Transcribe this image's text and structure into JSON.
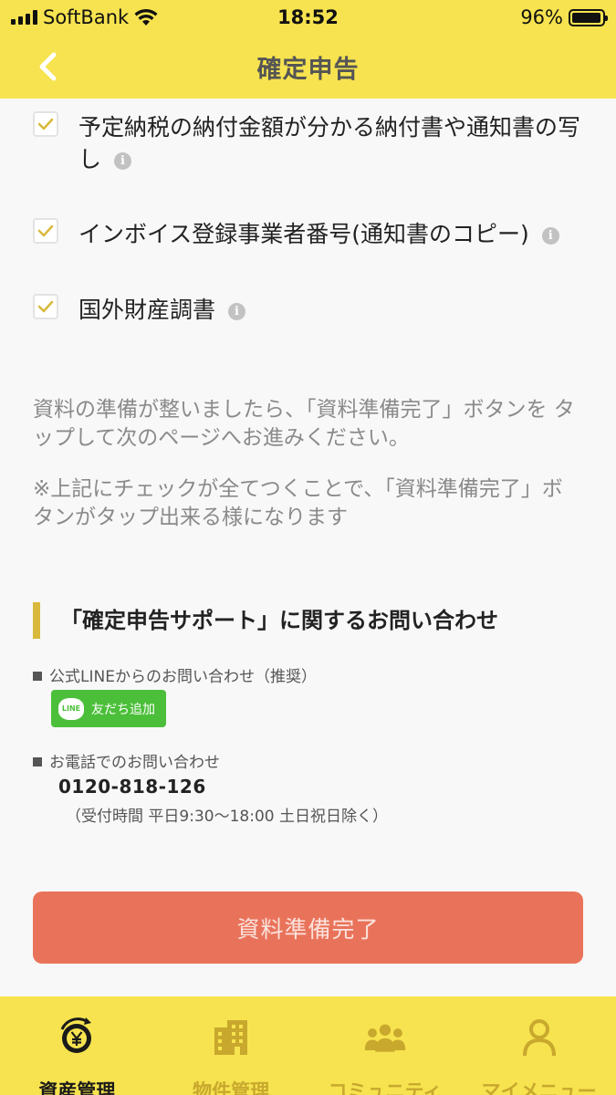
{
  "status_bar": {
    "carrier": "SoftBank",
    "time": "18:52",
    "battery": "96%",
    "battery_level": 0.96
  },
  "header": {
    "title": "確定申告",
    "back_icon": "chevron-left-icon"
  },
  "checklist": [
    {
      "label": "予定納税の納付金額が分かる納付書や通知書の写し",
      "checked": true
    },
    {
      "label": "インボイス登録事業者番号(通知書のコピー)",
      "checked": true
    },
    {
      "label": "国外財産調書",
      "checked": true
    }
  ],
  "info_glyph": "i",
  "notes": {
    "note1": "資料の準備が整いましたら、「資料準備完了」ボタンを タップして次のページへお進みください。",
    "note2": "※上記にチェックが全てつくことで、「資料準備完了」ボタンがタップ出来る様になります"
  },
  "support": {
    "title": "「確定申告サポート」に関するお問い合わせ",
    "line_label": "公式LINEからのお問い合わせ（推奨）",
    "line_logo_text": "LINE",
    "line_button": "友だち追加",
    "phone_label": "お電話でのお問い合わせ",
    "phone_number": "0120-818-126",
    "hours": "（受付時間 平日9:30〜18:00 土日祝日除く）"
  },
  "complete_button": "資料準備完了",
  "tabs": [
    {
      "label": "資産管理",
      "icon": "yen-coin-icon",
      "active": true
    },
    {
      "label": "物件管理",
      "icon": "building-icon",
      "active": false
    },
    {
      "label": "コミュニティ",
      "icon": "people-icon",
      "active": false
    },
    {
      "label": "マイメニュー",
      "icon": "person-icon",
      "active": false
    }
  ],
  "colors": {
    "brand_yellow": "#f6e34f",
    "accent_gold": "#d9b93b",
    "button_orange": "#e9735a",
    "line_green": "#4cbf3a"
  }
}
